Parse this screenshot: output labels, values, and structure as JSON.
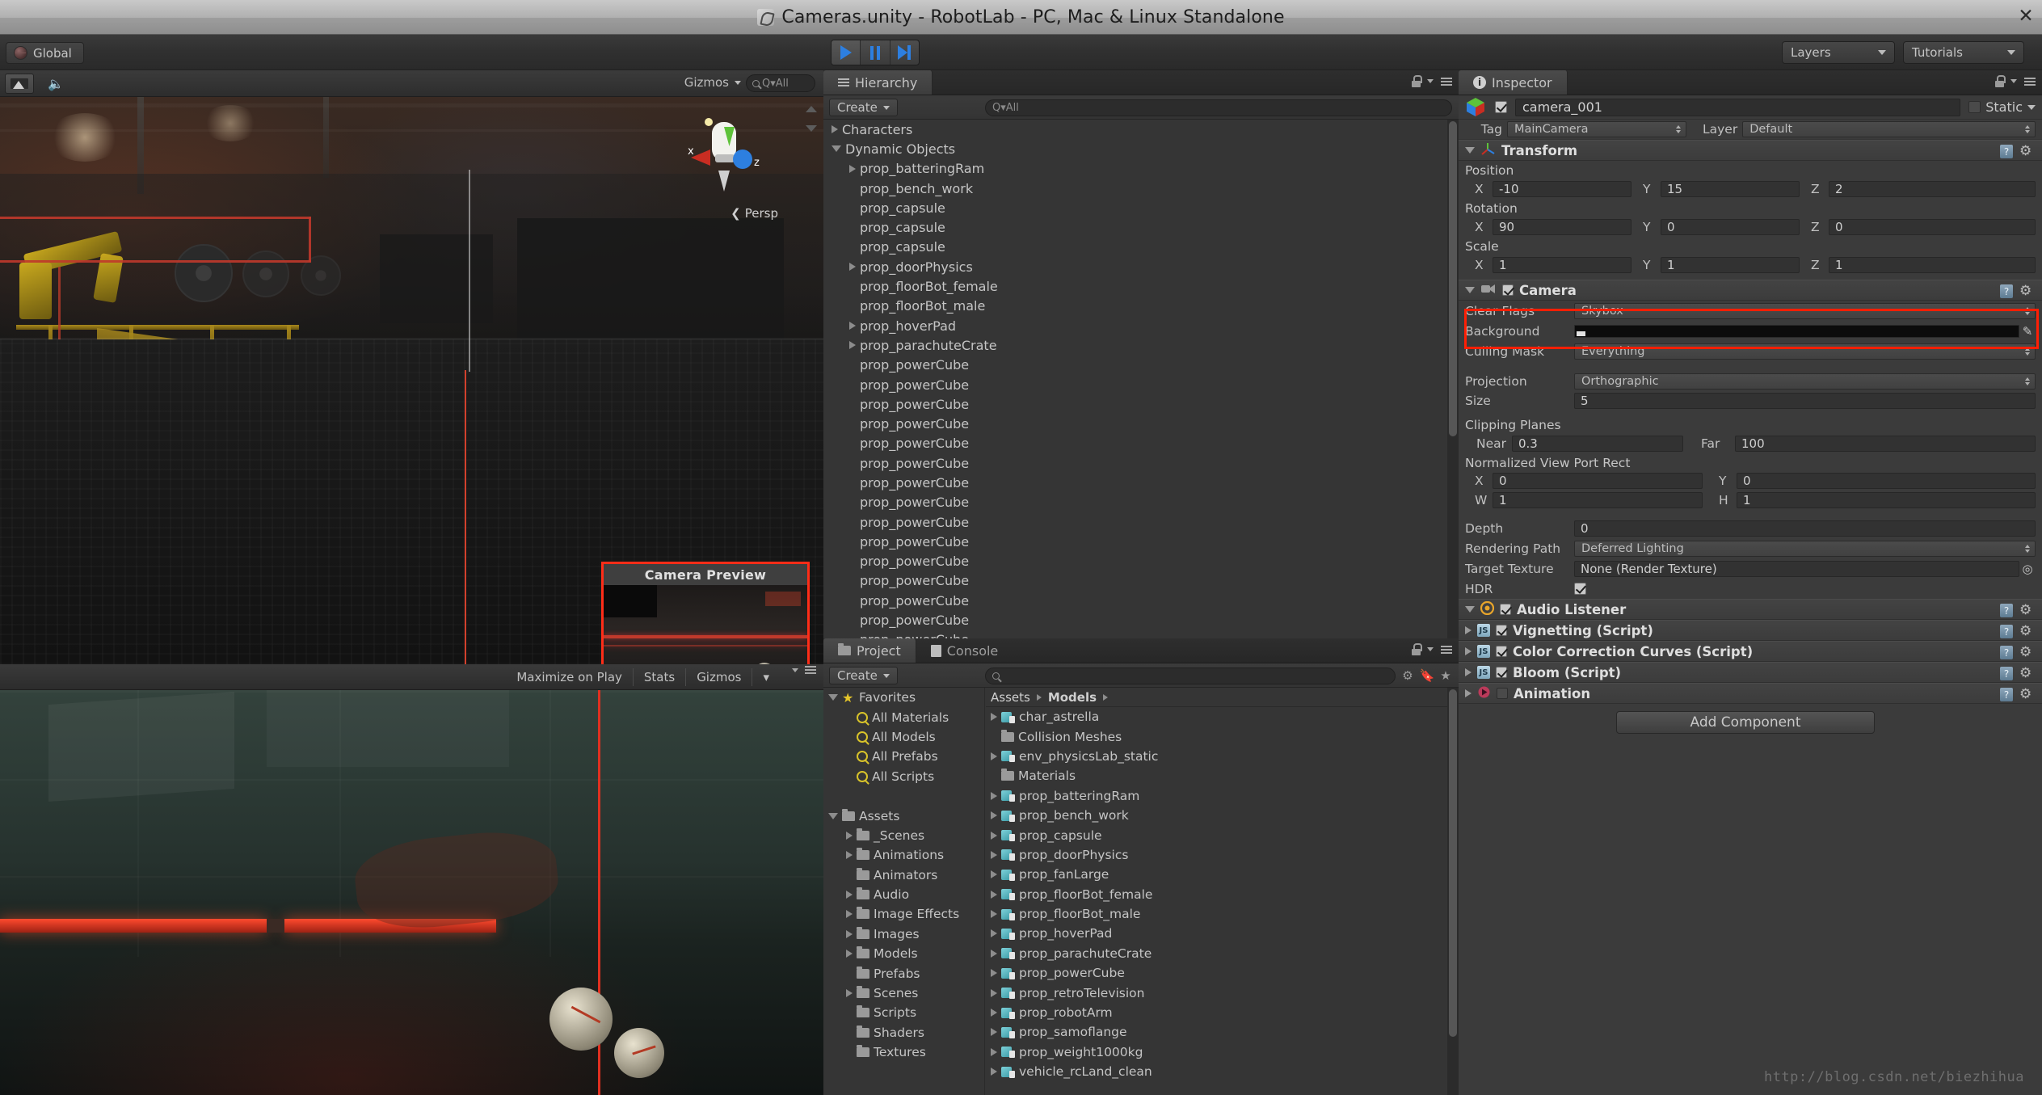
{
  "window": {
    "title": "Cameras.unity - RobotLab - PC, Mac & Linux Standalone",
    "close_label": "✕",
    "logo_icon": "unity-logo"
  },
  "toolbar": {
    "global_label": "Global",
    "play_icon": "play-icon",
    "pause_icon": "pause-icon",
    "step_icon": "step-icon",
    "layers_label": "Layers",
    "tutorials_label": "Tutorials"
  },
  "scene_view": {
    "lighting_icon": "scene-lighting-icon",
    "audio_icon": "scene-audio-icon",
    "gizmos_label": "Gizmos",
    "search_placeholder": "Q▾All",
    "persp_label": "Persp",
    "gizmo_axis_x": "x",
    "gizmo_axis_z": "z",
    "camera_preview_title": "Camera Preview"
  },
  "game_view": {
    "maximize_label": "Maximize on Play",
    "stats_label": "Stats",
    "gizmos_label": "Gizmos"
  },
  "hierarchy": {
    "tab_label": "Hierarchy",
    "tab_icon": "hierarchy-icon",
    "create_label": "Create",
    "search_placeholder": "Q▾All",
    "items": [
      {
        "label": "Characters",
        "indent": 0,
        "arrow": "closed"
      },
      {
        "label": "Dynamic Objects",
        "indent": 0,
        "arrow": "open"
      },
      {
        "label": "prop_batteringRam",
        "indent": 1,
        "arrow": "closed"
      },
      {
        "label": "prop_bench_work",
        "indent": 1,
        "arrow": "none"
      },
      {
        "label": "prop_capsule",
        "indent": 1,
        "arrow": "none"
      },
      {
        "label": "prop_capsule",
        "indent": 1,
        "arrow": "none"
      },
      {
        "label": "prop_capsule",
        "indent": 1,
        "arrow": "none"
      },
      {
        "label": "prop_doorPhysics",
        "indent": 1,
        "arrow": "closed"
      },
      {
        "label": "prop_floorBot_female",
        "indent": 1,
        "arrow": "none"
      },
      {
        "label": "prop_floorBot_male",
        "indent": 1,
        "arrow": "none"
      },
      {
        "label": "prop_hoverPad",
        "indent": 1,
        "arrow": "closed"
      },
      {
        "label": "prop_parachuteCrate",
        "indent": 1,
        "arrow": "closed"
      },
      {
        "label": "prop_powerCube",
        "indent": 1,
        "arrow": "none"
      },
      {
        "label": "prop_powerCube",
        "indent": 1,
        "arrow": "none"
      },
      {
        "label": "prop_powerCube",
        "indent": 1,
        "arrow": "none"
      },
      {
        "label": "prop_powerCube",
        "indent": 1,
        "arrow": "none"
      },
      {
        "label": "prop_powerCube",
        "indent": 1,
        "arrow": "none"
      },
      {
        "label": "prop_powerCube",
        "indent": 1,
        "arrow": "none"
      },
      {
        "label": "prop_powerCube",
        "indent": 1,
        "arrow": "none"
      },
      {
        "label": "prop_powerCube",
        "indent": 1,
        "arrow": "none"
      },
      {
        "label": "prop_powerCube",
        "indent": 1,
        "arrow": "none"
      },
      {
        "label": "prop_powerCube",
        "indent": 1,
        "arrow": "none"
      },
      {
        "label": "prop_powerCube",
        "indent": 1,
        "arrow": "none"
      },
      {
        "label": "prop_powerCube",
        "indent": 1,
        "arrow": "none"
      },
      {
        "label": "prop_powerCube",
        "indent": 1,
        "arrow": "none"
      },
      {
        "label": "prop_powerCube",
        "indent": 1,
        "arrow": "none"
      },
      {
        "label": "prop_powerCube",
        "indent": 1,
        "arrow": "none"
      }
    ]
  },
  "project": {
    "tab_label": "Project",
    "tab_icon": "folder-icon",
    "console_tab_label": "Console",
    "console_tab_icon": "console-icon",
    "create_label": "Create",
    "search_placeholder": "",
    "tool_icons": [
      "filter-by-type-icon",
      "filter-by-label-icon",
      "favorite-icon"
    ],
    "tree": [
      {
        "label": "Favorites",
        "indent": 0,
        "arrow": "open",
        "icon": "star-icon"
      },
      {
        "label": "All Materials",
        "indent": 1,
        "arrow": "none",
        "icon": "search-icon"
      },
      {
        "label": "All Models",
        "indent": 1,
        "arrow": "none",
        "icon": "search-icon"
      },
      {
        "label": "All Prefabs",
        "indent": 1,
        "arrow": "none",
        "icon": "search-icon"
      },
      {
        "label": "All Scripts",
        "indent": 1,
        "arrow": "none",
        "icon": "search-icon"
      },
      {
        "label": "",
        "indent": 0,
        "arrow": "none",
        "icon": "none"
      },
      {
        "label": "Assets",
        "indent": 0,
        "arrow": "open",
        "icon": "folder-icon"
      },
      {
        "label": "_Scenes",
        "indent": 1,
        "arrow": "closed",
        "icon": "folder-icon"
      },
      {
        "label": "Animations",
        "indent": 1,
        "arrow": "closed",
        "icon": "folder-icon"
      },
      {
        "label": "Animators",
        "indent": 1,
        "arrow": "none",
        "icon": "folder-icon"
      },
      {
        "label": "Audio",
        "indent": 1,
        "arrow": "closed",
        "icon": "folder-icon"
      },
      {
        "label": "Image Effects",
        "indent": 1,
        "arrow": "closed",
        "icon": "folder-icon"
      },
      {
        "label": "Images",
        "indent": 1,
        "arrow": "closed",
        "icon": "folder-icon"
      },
      {
        "label": "Models",
        "indent": 1,
        "arrow": "closed",
        "icon": "folder-icon"
      },
      {
        "label": "Prefabs",
        "indent": 1,
        "arrow": "none",
        "icon": "folder-icon"
      },
      {
        "label": "Scenes",
        "indent": 1,
        "arrow": "closed",
        "icon": "folder-icon"
      },
      {
        "label": "Scripts",
        "indent": 1,
        "arrow": "none",
        "icon": "folder-icon"
      },
      {
        "label": "Shaders",
        "indent": 1,
        "arrow": "none",
        "icon": "folder-icon"
      },
      {
        "label": "Textures",
        "indent": 1,
        "arrow": "none",
        "icon": "folder-icon"
      }
    ],
    "breadcrumb": [
      "Assets",
      "Models"
    ],
    "assets": [
      {
        "label": "char_astrella",
        "arrow": "closed",
        "icon": "model-icon"
      },
      {
        "label": "Collision Meshes",
        "arrow": "none",
        "icon": "folder-icon"
      },
      {
        "label": "env_physicsLab_static",
        "arrow": "closed",
        "icon": "model-icon"
      },
      {
        "label": "Materials",
        "arrow": "none",
        "icon": "folder-icon"
      },
      {
        "label": "prop_batteringRam",
        "arrow": "closed",
        "icon": "model-icon"
      },
      {
        "label": "prop_bench_work",
        "arrow": "closed",
        "icon": "model-icon"
      },
      {
        "label": "prop_capsule",
        "arrow": "closed",
        "icon": "model-icon"
      },
      {
        "label": "prop_doorPhysics",
        "arrow": "closed",
        "icon": "model-icon"
      },
      {
        "label": "prop_fanLarge",
        "arrow": "closed",
        "icon": "model-icon"
      },
      {
        "label": "prop_floorBot_female",
        "arrow": "closed",
        "icon": "model-icon"
      },
      {
        "label": "prop_floorBot_male",
        "arrow": "closed",
        "icon": "model-icon"
      },
      {
        "label": "prop_hoverPad",
        "arrow": "closed",
        "icon": "model-icon"
      },
      {
        "label": "prop_parachuteCrate",
        "arrow": "closed",
        "icon": "model-icon"
      },
      {
        "label": "prop_powerCube",
        "arrow": "closed",
        "icon": "model-icon"
      },
      {
        "label": "prop_retroTelevision",
        "arrow": "closed",
        "icon": "model-icon"
      },
      {
        "label": "prop_robotArm",
        "arrow": "closed",
        "icon": "model-icon"
      },
      {
        "label": "prop_samoflange",
        "arrow": "closed",
        "icon": "model-icon"
      },
      {
        "label": "prop_weight1000kg",
        "arrow": "closed",
        "icon": "model-icon"
      },
      {
        "label": "vehicle_rcLand_clean",
        "arrow": "closed",
        "icon": "model-icon"
      }
    ]
  },
  "inspector": {
    "tab_label": "Inspector",
    "tab_icon": "info-icon",
    "object_name": "camera_001",
    "static_label": "Static",
    "tag_label": "Tag",
    "tag_value": "MainCamera",
    "layer_label": "Layer",
    "layer_value": "Default",
    "transform": {
      "title": "Transform",
      "position_label": "Position",
      "rotation_label": "Rotation",
      "scale_label": "Scale",
      "axis_x": "X",
      "axis_y": "Y",
      "axis_z": "Z",
      "position": {
        "x": "-10",
        "y": "15",
        "z": "2"
      },
      "rotation": {
        "x": "90",
        "y": "0",
        "z": "0"
      },
      "scale": {
        "x": "1",
        "y": "1",
        "z": "1"
      }
    },
    "camera": {
      "title": "Camera",
      "clear_flags_label": "Clear Flags",
      "clear_flags_value": "Skybox",
      "background_label": "Background",
      "culling_mask_label": "Culling Mask",
      "culling_mask_value": "Everything",
      "projection_label": "Projection",
      "projection_value": "Orthographic",
      "size_label": "Size",
      "size_value": "5",
      "clipping_planes_label": "Clipping Planes",
      "near_label": "Near",
      "near_value": "0.3",
      "far_label": "Far",
      "far_value": "100",
      "viewport_label": "Normalized View Port Rect",
      "viewport": {
        "x_label": "X",
        "x": "0",
        "y_label": "Y",
        "y": "0",
        "w_label": "W",
        "w": "1",
        "h_label": "H",
        "h": "1"
      },
      "depth_label": "Depth",
      "depth_value": "0",
      "rendering_path_label": "Rendering Path",
      "rendering_path_value": "Deferred Lighting",
      "target_texture_label": "Target Texture",
      "target_texture_value": "None (Render Texture)",
      "hdr_label": "HDR"
    },
    "components": [
      {
        "title": "Audio Listener",
        "icon": "audio-listener-icon",
        "checked": true,
        "expanded": true
      },
      {
        "title": "Vignetting (Script)",
        "icon": "js-script-icon",
        "checked": true,
        "expanded": false
      },
      {
        "title": "Color Correction Curves (Script)",
        "icon": "js-script-icon",
        "checked": true,
        "expanded": false
      },
      {
        "title": "Bloom (Script)",
        "icon": "js-script-icon",
        "checked": true,
        "expanded": false
      },
      {
        "title": "Animation",
        "icon": "animation-icon",
        "checked": false,
        "expanded": false
      }
    ],
    "add_component_label": "Add Component",
    "highlight_color": "#ff1f05"
  },
  "watermark": {
    "text": "http://blog.csdn.net/biezhihua"
  }
}
